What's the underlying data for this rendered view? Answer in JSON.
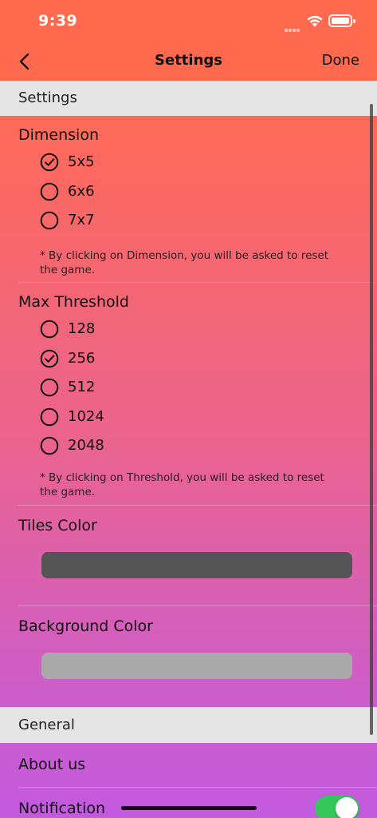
{
  "status_bar": {
    "time": "9:39"
  },
  "nav": {
    "title": "Settings",
    "done_label": "Done"
  },
  "sections": {
    "settings": "Settings",
    "general": "General"
  },
  "dimension": {
    "title": "Dimension",
    "options": [
      {
        "label": "5x5",
        "selected": true
      },
      {
        "label": "6x6",
        "selected": false
      },
      {
        "label": "7x7",
        "selected": false
      }
    ],
    "note_line1": "* By clicking on Dimension, you will be asked to reset",
    "note_line2": "the game."
  },
  "threshold": {
    "title": "Max Threshold",
    "options": [
      {
        "label": "128",
        "selected": false
      },
      {
        "label": "256",
        "selected": true
      },
      {
        "label": "512",
        "selected": false
      },
      {
        "label": "1024",
        "selected": false
      },
      {
        "label": "2048",
        "selected": false
      }
    ],
    "note_line1": "* By clicking on Threshold, you will be asked to reset",
    "note_line2": "the game."
  },
  "tiles_color": {
    "title": "Tiles Color",
    "color": "#555555"
  },
  "background_color": {
    "title": "Background Color",
    "color": "#A9A9A9"
  },
  "general": {
    "about_label": "About us",
    "notification_label": "Notification",
    "notification_on": true
  },
  "colors": {
    "accent": "#FF6A4E",
    "toggle_on": "#34C759"
  },
  "icons": {
    "back": "chevron-left-icon",
    "selected": "checkmark-circle-icon",
    "unselected": "empty-circle-icon"
  }
}
